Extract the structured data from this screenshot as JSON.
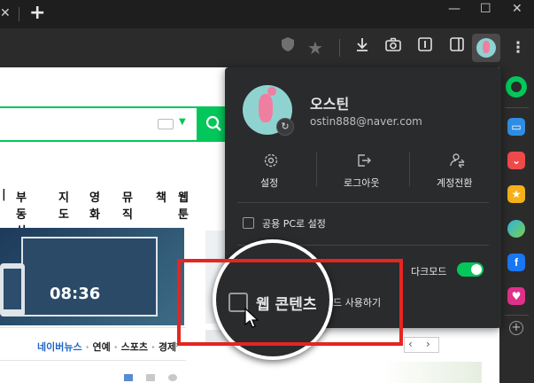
{
  "browser": {
    "new_tab_label": "+",
    "window_controls": {
      "minimize": "—",
      "maximize": "☐",
      "close": "✕"
    },
    "toolbar_icons": [
      "shield-icon",
      "star-icon",
      "download-icon",
      "camera-icon",
      "reader-icon",
      "sidebar-toggle-icon",
      "profile-avatar-icon",
      "more-menu-icon"
    ]
  },
  "page": {
    "nav_items": [
      "부동산",
      "지도",
      "영화",
      "뮤직",
      "책",
      "웹툰"
    ],
    "news_tabs": {
      "source": "네이버뉴스",
      "items": [
        "연예",
        "스포츠",
        "경제"
      ]
    },
    "clock_time": "08:36"
  },
  "profile": {
    "name": "오스틴",
    "email": "ostin888@naver.com",
    "actions": [
      {
        "label": "설정",
        "icon": "gear-icon"
      },
      {
        "label": "로그아웃",
        "icon": "logout-icon"
      },
      {
        "label": "계정전환",
        "icon": "switch-account-icon"
      }
    ],
    "public_pc_label": "공용 PC로 설정",
    "dark_mode_label": "다크모드",
    "dark_mode_on": true,
    "web_content_label": "웹 콘텐츠",
    "web_content_suffix": "드 사용하기"
  },
  "colors": {
    "naver_green": "#03c75a",
    "toggle_on": "#03c75a",
    "highlight_red": "#e52521"
  }
}
